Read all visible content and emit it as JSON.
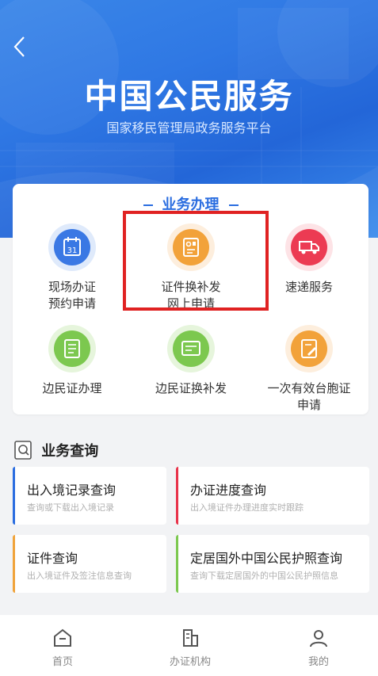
{
  "header": {
    "title": "中国公民服务",
    "subtitle": "国家移民管理局政务服务平台"
  },
  "business": {
    "heading": "业务办理",
    "services": [
      {
        "line1": "现场办证",
        "line2": "预约申请"
      },
      {
        "line1": "证件换补发",
        "line2": "网上申请"
      },
      {
        "line1": "速递服务",
        "line2": ""
      },
      {
        "line1": "边民证办理",
        "line2": ""
      },
      {
        "line1": "边民证换补发",
        "line2": ""
      },
      {
        "line1": "一次有效台胞证",
        "line2": "申请"
      }
    ]
  },
  "query": {
    "heading": "业务查询",
    "items": [
      {
        "title": "出入境记录查询",
        "subtitle": "查询或下载出入境记录",
        "color": "#2a6de0"
      },
      {
        "title": "办证进度查询",
        "subtitle": "出入境证件办理进度实时跟踪",
        "color": "#e8334a"
      },
      {
        "title": "证件查询",
        "subtitle": "出入境证件及签注信息查询",
        "color": "#f0a33a"
      },
      {
        "title": "定居国外中国公民护照查询",
        "subtitle": "查询下载定居国外的中国公民护照信息",
        "color": "#7cc84f"
      }
    ]
  },
  "tabs": [
    {
      "label": "首页"
    },
    {
      "label": "办证机构"
    },
    {
      "label": "我的"
    }
  ],
  "colors": {
    "primary": "#2a6de0",
    "highlight_border": "#e02222"
  }
}
